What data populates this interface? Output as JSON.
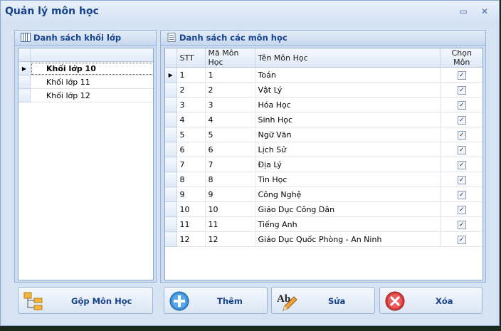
{
  "window": {
    "title": "Quản lý môn học",
    "minimize_glyph": "▭",
    "close_glyph": "✕"
  },
  "left_panel": {
    "title": "Danh sách khối lớp",
    "icon": "grid-icon",
    "selected_indicator": "▶",
    "rows": [
      {
        "name": "Khối lớp 10",
        "selected": true
      },
      {
        "name": "Khối lớp 11",
        "selected": false
      },
      {
        "name": "Khối lớp 12",
        "selected": false
      }
    ]
  },
  "right_panel": {
    "title": "Danh sách các môn học",
    "icon": "document-icon",
    "columns": [
      "STT",
      "Mã Môn Học",
      "Tên Môn Học",
      "Chọn Môn"
    ],
    "check_glyph": "✓",
    "rows": [
      {
        "stt": "1",
        "ma": "1",
        "ten": "Toán",
        "chon": true
      },
      {
        "stt": "2",
        "ma": "2",
        "ten": "Vật Lý",
        "chon": true
      },
      {
        "stt": "3",
        "ma": "3",
        "ten": "Hóa Học",
        "chon": true
      },
      {
        "stt": "4",
        "ma": "4",
        "ten": "Sinh Học",
        "chon": true
      },
      {
        "stt": "5",
        "ma": "5",
        "ten": "Ngữ Văn",
        "chon": true
      },
      {
        "stt": "6",
        "ma": "6",
        "ten": "Lịch Sử",
        "chon": true
      },
      {
        "stt": "7",
        "ma": "7",
        "ten": "Địa Lý",
        "chon": true
      },
      {
        "stt": "8",
        "ma": "8",
        "ten": "Tin Học",
        "chon": true
      },
      {
        "stt": "9",
        "ma": "9",
        "ten": "Công Nghệ",
        "chon": true
      },
      {
        "stt": "10",
        "ma": "10",
        "ten": "Giáo Dục Công Dân",
        "chon": true
      },
      {
        "stt": "11",
        "ma": "11",
        "ten": "Tiếng Anh",
        "chon": true
      },
      {
        "stt": "12",
        "ma": "12",
        "ten": "Giáo Dục Quốc Phòng - An Ninh",
        "chon": true
      }
    ]
  },
  "buttons": {
    "merge": {
      "label": "Gộp Môn Học",
      "icon": "hierarchy-icon"
    },
    "add": {
      "label": "Thêm",
      "icon": "plus-circle-icon"
    },
    "edit": {
      "label": "Sửa",
      "icon": "edit-pencil-icon",
      "icon_text": "Ab"
    },
    "delete": {
      "label": "Xóa",
      "icon": "delete-x-icon"
    }
  },
  "colors": {
    "title": "#15428b",
    "accent": "#3b8fd8",
    "delete": "#d83a3a"
  }
}
